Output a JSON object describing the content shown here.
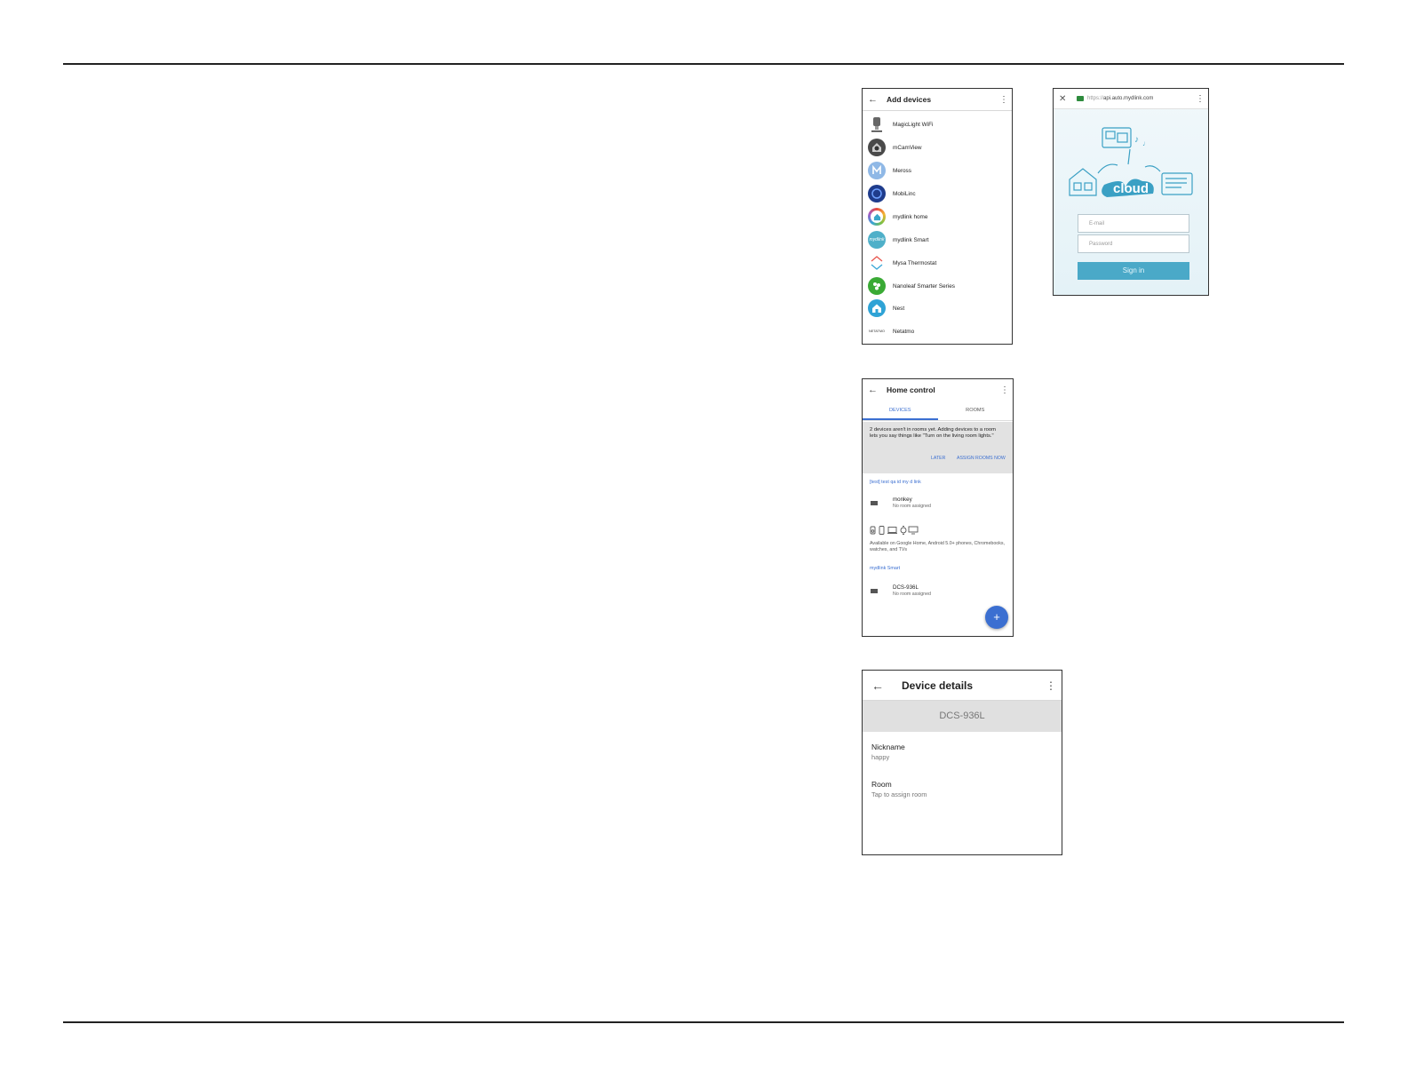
{
  "add_devices": {
    "title": "Add devices",
    "back_icon": "←",
    "more_icon": "⋮",
    "items": [
      {
        "label": "MagicLight WiFi",
        "icon": "magiclight-icon",
        "color": "#ffffff"
      },
      {
        "label": "mCamView",
        "icon": "mcamview-icon",
        "color": "#4a4a4a"
      },
      {
        "label": "Meross",
        "icon": "meross-icon",
        "color": "#8fb8e6"
      },
      {
        "label": "MobiLinc",
        "icon": "mobilinc-icon",
        "color": "#1f3c8c"
      },
      {
        "label": "mydlink home",
        "icon": "mydlink-home-icon",
        "color": "#3aa7c9"
      },
      {
        "label": "mydlink Smart",
        "icon": "mydlink-smart-icon",
        "color": "#4fb0c9"
      },
      {
        "label": "Mysa Thermostat",
        "icon": "mysa-icon",
        "color": "#ffffff"
      },
      {
        "label": "Nanoleaf Smarter Series",
        "icon": "nanoleaf-icon",
        "color": "#3aaa35"
      },
      {
        "label": "Nest",
        "icon": "nest-icon",
        "color": "#2fa3d6"
      },
      {
        "label": "Netatmo",
        "icon": "netatmo-icon",
        "color": "#ffffff",
        "logo_text": "NETATMO"
      }
    ]
  },
  "cloud_login": {
    "close_icon": "✕",
    "url_scheme": "https://",
    "url_host": "api.auto.mydlink.com",
    "more_icon": "⋮",
    "email_placeholder": "E-mail",
    "password_placeholder": "Password",
    "signin_label": "Sign in",
    "logo_text": "cloud"
  },
  "home_control": {
    "title": "Home control",
    "back_icon": "←",
    "more_icon": "⋮",
    "tabs": [
      "DEVICES",
      "ROOMS"
    ],
    "banner_text": "2 devices aren't in rooms yet. Adding devices to a room lets you say things like \"Turn on the living room lights.\"",
    "later_label": "LATER",
    "assign_label": "ASSIGN ROOMS NOW",
    "section1": "[test] test qa id my d link",
    "device1_name": "monkey",
    "device1_sub": "No room assigned",
    "available_text": "Available on Google Home, Android 5.0+ phones, Chromebooks, watches, and TVs",
    "section2": "mydlink Smart",
    "device2_name": "DCS-936L",
    "device2_sub": "No room assigned",
    "fab_icon": "+"
  },
  "device_details": {
    "title": "Device details",
    "back_icon": "←",
    "more_icon": "⋮",
    "model": "DCS-936L",
    "nickname_label": "Nickname",
    "nickname_value": "happy",
    "room_label": "Room",
    "room_value": "Tap to assign room"
  }
}
